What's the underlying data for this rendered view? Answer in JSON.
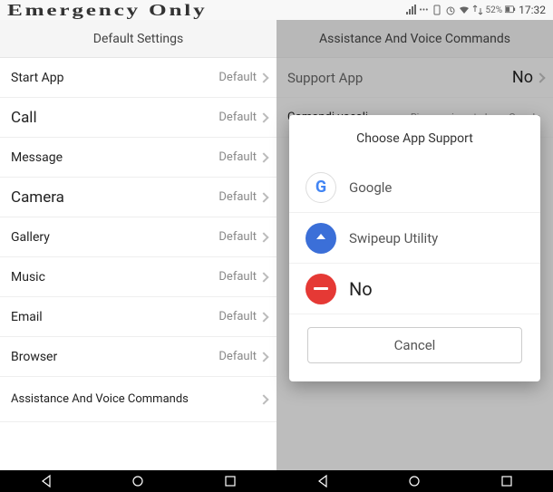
{
  "status_bar": {
    "carrier": "Emergency Only",
    "time": "17:32",
    "battery": "52%",
    "icons": [
      "signal-icon",
      "nfc-icon",
      "more-icon",
      "vibrate-icon",
      "alarm-icon",
      "wifi-icon",
      "data-icon",
      "battery-icon"
    ]
  },
  "left": {
    "header": "Default Settings",
    "rows": [
      {
        "label": "Start App",
        "value": "Default"
      },
      {
        "label": "Call",
        "value": "Default",
        "tall": true
      },
      {
        "label": "Message",
        "value": "Default"
      },
      {
        "label": "Camera",
        "value": "Default",
        "tall": true
      },
      {
        "label": "Gallery",
        "value": "Default"
      },
      {
        "label": "Music",
        "value": "Default"
      },
      {
        "label": "Email",
        "value": "Default"
      },
      {
        "label": "Browser",
        "value": "Default"
      },
      {
        "label": "Assistance And Voice Commands",
        "value": ""
      }
    ]
  },
  "right": {
    "header": "Assistance And Voice Commands",
    "rows": [
      {
        "label": "Support App",
        "value": "No",
        "no": true
      },
      {
        "label": "Comandi vocali",
        "value": "Riconoscimento base Google"
      }
    ],
    "dialog": {
      "title": "Choose App Support",
      "options": [
        {
          "label": "Google",
          "icon": "google"
        },
        {
          "label": "Swipeup Utility",
          "icon": "swipe"
        },
        {
          "label": "No",
          "icon": "no",
          "big": true
        }
      ],
      "cancel": "Cancel"
    }
  },
  "navbar": {
    "back": "back",
    "home": "home",
    "recent": "recent"
  }
}
